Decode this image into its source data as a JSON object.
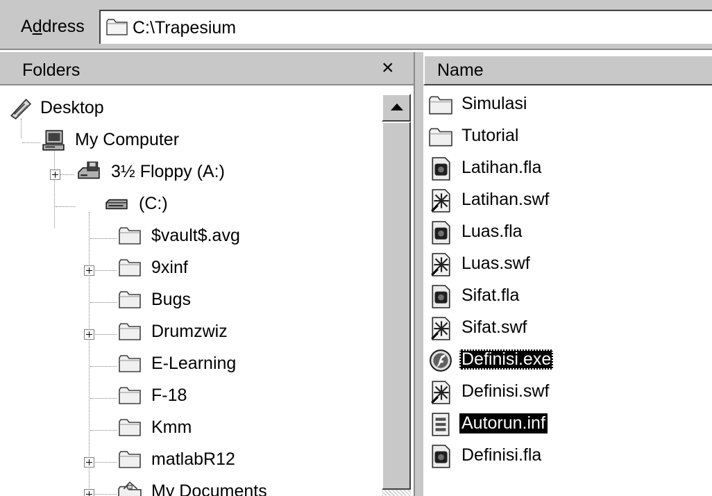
{
  "address": {
    "label_prefix": "A",
    "label_underlined": "d",
    "label_suffix": "dress",
    "value": "C:\\Trapesium"
  },
  "folders": {
    "title": "Folders",
    "close_label": "×",
    "tree": [
      {
        "label": "Desktop",
        "icon": "desktop-icon"
      },
      {
        "label": "My Computer",
        "icon": "computer-icon"
      },
      {
        "label": "3½ Floppy (A:)",
        "icon": "floppy-drive-icon",
        "expandable": true
      },
      {
        "label": "(C:)",
        "icon": "hard-drive-icon"
      },
      {
        "label": "$vault$.avg",
        "icon": "folder-icon"
      },
      {
        "label": "9xinf",
        "icon": "folder-icon",
        "expandable": true
      },
      {
        "label": "Bugs",
        "icon": "folder-icon"
      },
      {
        "label": "Drumzwiz",
        "icon": "folder-icon",
        "expandable": true
      },
      {
        "label": "E-Learning",
        "icon": "folder-icon"
      },
      {
        "label": "F-18",
        "icon": "folder-icon"
      },
      {
        "label": "Kmm",
        "icon": "folder-icon"
      },
      {
        "label": "matlabR12",
        "icon": "folder-icon",
        "expandable": true
      },
      {
        "label": "My Documents",
        "icon": "my-documents-icon",
        "expandable": true
      }
    ]
  },
  "list": {
    "column_name": "Name",
    "files": [
      {
        "label": "Simulasi",
        "icon": "folder-icon"
      },
      {
        "label": "Tutorial",
        "icon": "folder-icon"
      },
      {
        "label": "Latihan.fla",
        "icon": "flash-document-icon"
      },
      {
        "label": "Latihan.swf",
        "icon": "flash-movie-icon"
      },
      {
        "label": "Luas.fla",
        "icon": "flash-document-icon"
      },
      {
        "label": "Luas.swf",
        "icon": "flash-movie-icon"
      },
      {
        "label": "Sifat.fla",
        "icon": "flash-document-icon"
      },
      {
        "label": "Sifat.swf",
        "icon": "flash-movie-icon"
      },
      {
        "label": "Definisi.exe",
        "icon": "flash-player-icon",
        "selected": true,
        "focused": true
      },
      {
        "label": "Definisi.swf",
        "icon": "flash-movie-icon"
      },
      {
        "label": "Autorun.inf",
        "icon": "settings-file-icon",
        "selected": true
      },
      {
        "label": "Definisi.fla",
        "icon": "flash-document-icon"
      }
    ]
  }
}
